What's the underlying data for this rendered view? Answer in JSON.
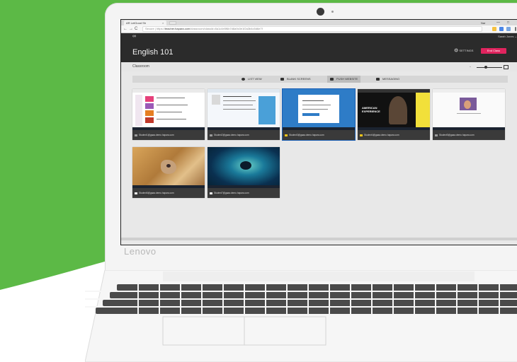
{
  "colors": {
    "background_green": "#5cb946",
    "app_dark": "#2b2b2b",
    "end_button": "#e0245e",
    "screen_bg": "#e8e8e8"
  },
  "device": {
    "brand": "Lenovo"
  },
  "browser": {
    "tab_label": "AR LetGood Sh",
    "tab_close": "×",
    "user_chip": "Nar",
    "win_controls": [
      "—",
      "□",
      "✕"
    ],
    "nav_icons": [
      "←",
      "→",
      "C"
    ],
    "url_prefix": "Secure | https://",
    "url_host": "teacher.hapara.com",
    "url_rest": "/classroom/classId=8a1c4e5f6b7d8a9c0e1f2a3b4c5d6e7f"
  },
  "app": {
    "logo": "∞",
    "user_name": "Sarah Jones ⌄",
    "class_title": "English 101",
    "settings_label": "SETTINGS",
    "settings_icon": "gear-icon",
    "end_class_label": "End Class",
    "classroom_label": "Classroom"
  },
  "modes": [
    {
      "label": "LIST VIEW",
      "icon": "list-icon",
      "active": false
    },
    {
      "label": "BLANK SCREENS",
      "icon": "blank-screen-icon",
      "active": false
    },
    {
      "label": "PUSH WEBSITE",
      "icon": "push-website-icon",
      "active": true
    },
    {
      "label": "MESSAGING",
      "icon": "message-icon",
      "active": false
    }
  ],
  "zoom": {
    "level": 0.35
  },
  "students": [
    {
      "caption": "Student1@gaaa.demo.hapara.com"
    },
    {
      "caption": "Student2@gaaa.demo.hapara.com"
    },
    {
      "caption": "Student3@gaaa.demo.hapara.com"
    },
    {
      "caption": "Student4@gaaa.demo.hapara.com"
    },
    {
      "caption": "Student5@gaaa.demo.hapara.com"
    },
    {
      "caption": "Student6@gaaa.demo.hapara.com"
    },
    {
      "caption": "Student7@gaaa.demo.hapara.com"
    }
  ],
  "thumb4_text": "AMERICAN EXPERIENCE"
}
